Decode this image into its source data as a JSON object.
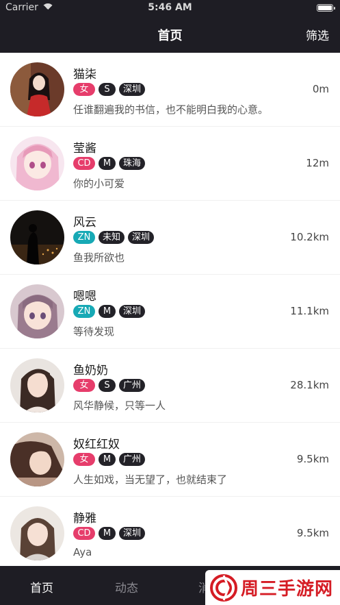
{
  "status": {
    "carrier": "Carrier",
    "time": "5:46 AM"
  },
  "nav": {
    "title": "首页",
    "filter": "筛选"
  },
  "users": [
    {
      "name": "猫柒",
      "gender": "女",
      "size": "S",
      "city": "深圳",
      "distance": "0m",
      "signature": "任谁翻遍我的书信，也不能明白我的心意。"
    },
    {
      "name": "莹酱",
      "gender": "CD",
      "size": "M",
      "city": "珠海",
      "distance": "12m",
      "signature": "你的小可爱"
    },
    {
      "name": "风云",
      "gender": "ZN",
      "size": "未知",
      "city": "深圳",
      "distance": "10.2km",
      "signature": "鱼我所欲也"
    },
    {
      "name": "嗯嗯",
      "gender": "ZN",
      "size": "M",
      "city": "深圳",
      "distance": "11.1km",
      "signature": "等待发现"
    },
    {
      "name": "鱼奶奶",
      "gender": "女",
      "size": "S",
      "city": "广州",
      "distance": "28.1km",
      "signature": "风华静候，只等一人"
    },
    {
      "name": "奴红红奴",
      "gender": "女",
      "size": "M",
      "city": "广州",
      "distance": "9.5km",
      "signature": "人生如戏，当无望了，也就结束了"
    },
    {
      "name": "静雅",
      "gender": "CD",
      "size": "M",
      "city": "深圳",
      "distance": "9.5km",
      "signature": "Aya"
    }
  ],
  "tabbar": {
    "home": "首页",
    "feed": "动态",
    "partial": "消"
  },
  "watermark": {
    "text": "周三手游网"
  },
  "colors": {
    "dark_bar": "#1e1d24",
    "tag_female": "#e63d6b",
    "tag_zn": "#17a9b5",
    "tag_dark": "#232228"
  }
}
